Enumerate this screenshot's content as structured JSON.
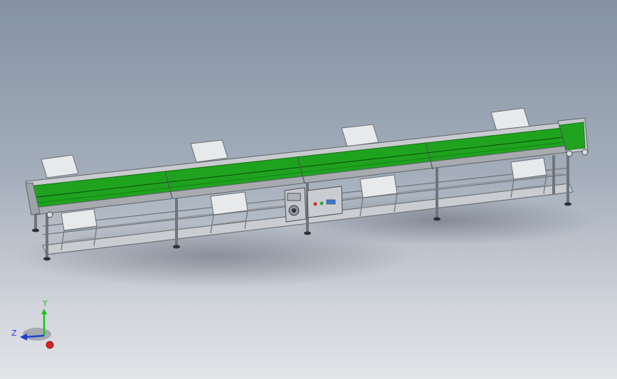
{
  "viewport": {
    "background_top": "#8592a3",
    "background_bottom": "#e2e4e8"
  },
  "model": {
    "belt_color": "#1fa31f",
    "frame_color": "#b4b8bc",
    "leg_color": "#8c9196",
    "table_color": "#e6e7e9",
    "control_box": {
      "indicator_red": "#d42a2a",
      "indicator_green": "#2aa84a",
      "display": "#3b78c9"
    },
    "station_tables": 8,
    "belt_sections": 4
  },
  "triad": {
    "y_label": "Y",
    "z_label": "Z",
    "x_color": "#e02020",
    "y_color": "#20c020",
    "z_color": "#2040d0"
  }
}
